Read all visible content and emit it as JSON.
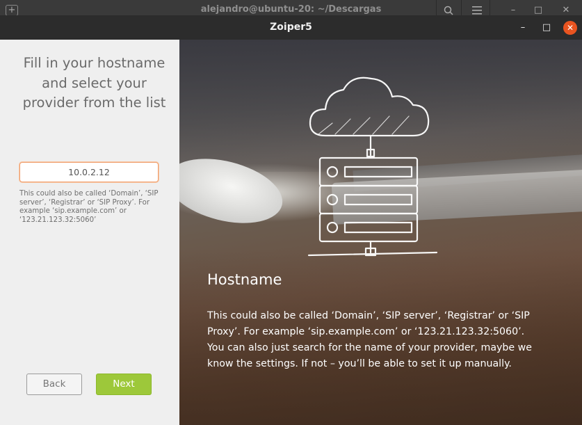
{
  "background_terminal": {
    "title": "alejandro@ubuntu-20: ~/Descargas",
    "new_tab_glyph": "+",
    "search_icon": "search-icon",
    "menu_icon": "hamburger-menu-icon",
    "minimize_glyph": "–",
    "maximize_glyph": "□",
    "close_glyph": "✕"
  },
  "window": {
    "title": "Zoiper5",
    "minimize_glyph": "–",
    "maximize_glyph": "□",
    "close_glyph": "✕",
    "close_color": "#e95420"
  },
  "left_panel": {
    "heading": "Fill in your hostname and select your provider from the list",
    "hostname_value": "10.0.2.12",
    "hint": "This could also be called ‘Domain’, ‘SIP server’, ‘Registrar’ or ‘SIP Proxy’. For example ‘sip.example.com’ or ‘123.21.123.32:5060’",
    "back_label": "Back",
    "next_label": "Next",
    "next_color": "#9dc83a"
  },
  "right_panel": {
    "illustration_icon": "cloud-server-icon",
    "title": "Hostname",
    "body_line1": " This could also be called ‘Domain’, ‘SIP server’, ‘Registrar’ or ‘SIP Proxy’. For example ‘sip.example.com’ or ‘123.21.123.32:5060’.",
    "body_line2": "You can also just search for the name of your provider, maybe we know the settings. If not – you’ll be able to set it up manually."
  }
}
